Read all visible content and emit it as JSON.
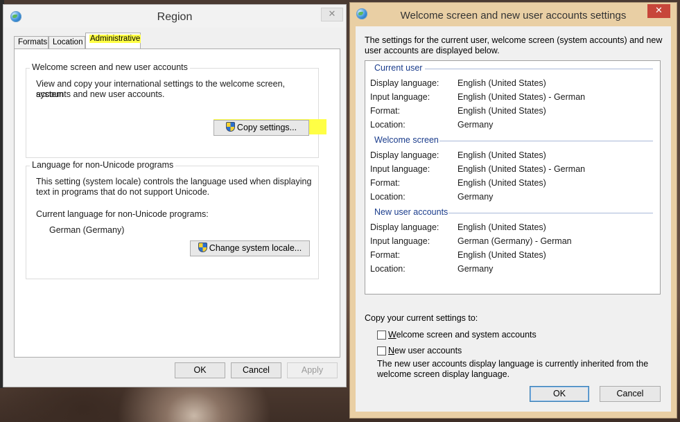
{
  "region": {
    "title": "Region",
    "close_glyph": "✕",
    "tabs": [
      {
        "label": "Formats"
      },
      {
        "label": "Location"
      },
      {
        "label": "Administrative",
        "selected": true
      }
    ],
    "welcome_group": {
      "legend": "Welcome screen and new user accounts",
      "description_line1": "View and copy your international settings to the welcome screen, system",
      "description_line2": "accounts and new user accounts.",
      "copy_button": "Copy settings..."
    },
    "nonunicode_group": {
      "legend": "Language for non-Unicode programs",
      "description_line1": "This setting (system locale) controls the language used when displaying",
      "description_line2": "text in programs that do not support Unicode.",
      "current_label": "Current language for non-Unicode programs:",
      "current_value": "German (Germany)",
      "change_button": "Change system locale..."
    },
    "buttons": {
      "ok": "OK",
      "cancel": "Cancel",
      "apply": "Apply"
    },
    "colors": {
      "highlight": "#ffff45"
    }
  },
  "welcome_window": {
    "title": "Welcome screen and new user accounts settings",
    "close_glyph": "✕",
    "intro_line1": "The settings for the current user, welcome screen (system accounts) and new",
    "intro_line2": "user accounts are displayed below.",
    "sections": [
      {
        "heading": "Current user",
        "rows": [
          {
            "label": "Display language:",
            "value": "English (United States)"
          },
          {
            "label": "Input language:",
            "value": "English (United States) - German"
          },
          {
            "label": "Format:",
            "value": "English (United States)"
          },
          {
            "label": "Location:",
            "value": "Germany"
          }
        ]
      },
      {
        "heading": "Welcome screen",
        "rows": [
          {
            "label": "Display language:",
            "value": "English (United States)"
          },
          {
            "label": "Input language:",
            "value": "English (United States) - German"
          },
          {
            "label": "Format:",
            "value": "English (United States)"
          },
          {
            "label": "Location:",
            "value": "Germany"
          }
        ]
      },
      {
        "heading": "New user accounts",
        "rows": [
          {
            "label": "Display language:",
            "value": "English (United States)"
          },
          {
            "label": "Input language:",
            "value": "German (Germany) - German"
          },
          {
            "label": "Format:",
            "value": "English (United States)"
          },
          {
            "label": "Location:",
            "value": "Germany"
          }
        ]
      }
    ],
    "copy_to_label": "Copy your current settings to:",
    "checkbox_welcome": {
      "label_ul": "W",
      "label_rest": "elcome screen and system accounts",
      "checked": false
    },
    "checkbox_new_users": {
      "label_ul": "N",
      "label_rest": "ew user accounts",
      "checked": false
    },
    "note_line1": "The new user accounts display language is currently inherited from the",
    "note_line2": "welcome screen display language.",
    "buttons": {
      "ok": "OK",
      "cancel": "Cancel"
    },
    "colors": {
      "frame": "#e9cfa4",
      "close": "#c7463a",
      "section_heading": "#1a3c8c"
    }
  }
}
